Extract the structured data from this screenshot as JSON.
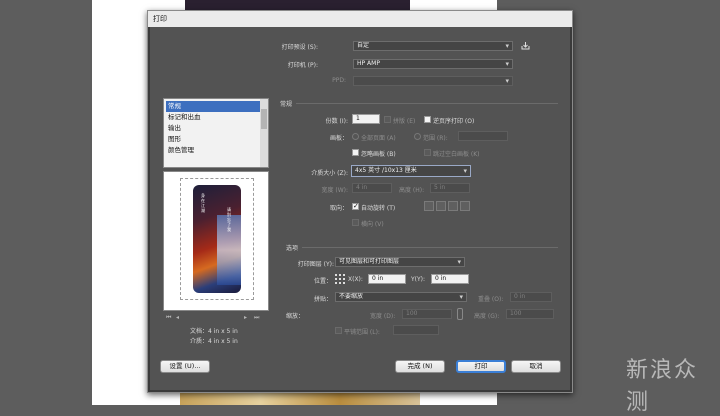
{
  "window": {
    "title": "打印"
  },
  "top": {
    "preset_label": "打印预设 (S):",
    "preset_value": "自定",
    "printer_label": "打印机 (P):",
    "printer_value": "HP AMP",
    "ppd_label": "PPD:",
    "ppd_value": ""
  },
  "sidebar": {
    "items": [
      {
        "label": "常规",
        "selected": true
      },
      {
        "label": "标记和出血",
        "selected": false
      },
      {
        "label": "输出",
        "selected": false
      },
      {
        "label": "图形",
        "selected": false
      },
      {
        "label": "颜色管理",
        "selected": false
      }
    ]
  },
  "preview": {
    "doc_label": "文档：4 in x 5 in",
    "media_label": "介质：4 in x 5 in",
    "art_text_left": "身在江湖",
    "art_text_right": "请别忘了我"
  },
  "general": {
    "section_title": "常规",
    "copies_label": "份数 (I):",
    "copies_value": "1",
    "collate_label": "拼版 (E)",
    "reverse_label": "逆页序打印 (O)",
    "artboard_label": "画板：",
    "all_pages_label": "全部页面 (A)",
    "range_label": "范围 (R):",
    "ignore_artboards_label": "忽略画板 (B)",
    "skip_blank_label": "跳过空白画板 (K)",
    "media_size_label": "介质大小 (Z):",
    "media_size_value": "4x5 英寸 /10x13 厘米",
    "width_label": "宽度 (W):",
    "width_value": "4 in",
    "height_label": "高度 (H):",
    "height_value": "5 in",
    "orientation_label": "取向：",
    "auto_rotate_label": "自动旋转 (T)",
    "transverse_label": "横向 (V)"
  },
  "options": {
    "section_title": "选项",
    "print_layers_label": "打印图层 (Y):",
    "print_layers_value": "可见图层和可打印图层",
    "placement_label": "位置：",
    "x_label": "X(X):",
    "x_value": "0 in",
    "y_label": "Y(Y):",
    "y_value": "0 in",
    "tiling_label": "拼贴：",
    "tiling_value": "不要缩放",
    "overlap_label": "重叠 (O):",
    "overlap_value": "0 in",
    "scale_label": "缩放：",
    "scale_w_label": "宽度 (D):",
    "scale_w_value": "100",
    "scale_h_label": "高度 (G):",
    "scale_h_value": "100",
    "tile_range_label": "平铺范围 (L):"
  },
  "buttons": {
    "setup": "设置 (U)...",
    "done": "完成 (N)",
    "print": "打印",
    "cancel": "取消"
  },
  "watermark": {
    "text": "新浪众测"
  }
}
